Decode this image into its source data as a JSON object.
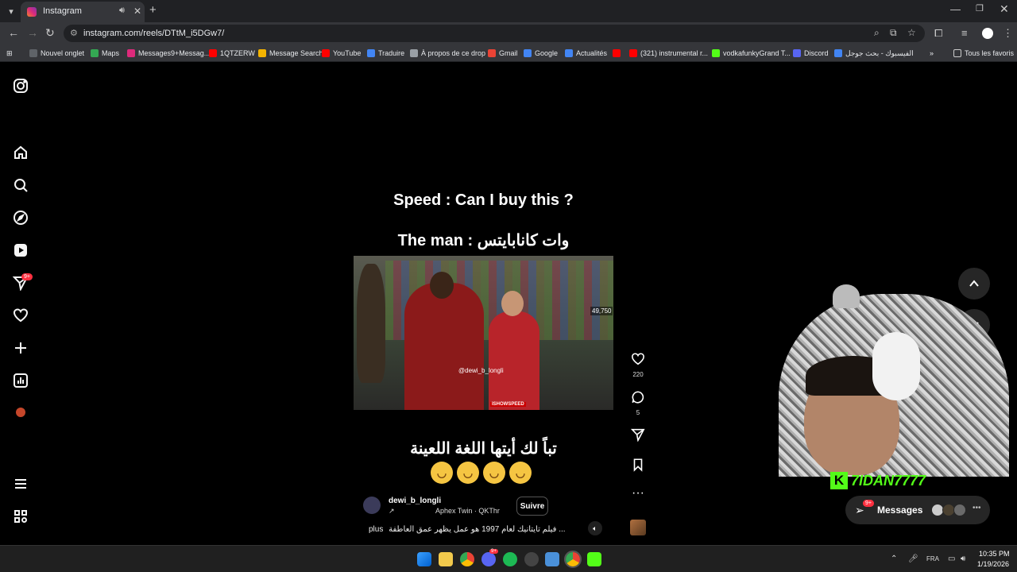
{
  "browser": {
    "tab_title": "Instagram",
    "url": "instagram.com/reels/DTtM_i5DGw7/",
    "bookmarks": [
      {
        "label": "Nouvel onglet",
        "color": "#5f6368"
      },
      {
        "label": "Maps",
        "color": "#34a853"
      },
      {
        "label": "Messages9+Messag...",
        "color": "#dd2a7b"
      },
      {
        "label": "1QTZERW",
        "color": "#ff0000"
      },
      {
        "label": "Message Search",
        "color": "#f4b400"
      },
      {
        "label": "YouTube",
        "color": "#ff0000"
      },
      {
        "label": "Traduire",
        "color": "#4285f4"
      },
      {
        "label": "À propos de ce drop",
        "color": "#9aa0a6"
      },
      {
        "label": "Gmail",
        "color": "#ea4335"
      },
      {
        "label": "Google",
        "color": "#4285f4"
      },
      {
        "label": "Actualités",
        "color": "#4285f4"
      },
      {
        "label": "",
        "color": "#ff0000"
      },
      {
        "label": "(321) instrumental r...",
        "color": "#ff0000"
      },
      {
        "label": "vodkafunkyGrand T...",
        "color": "#53fc18"
      },
      {
        "label": "Discord",
        "color": "#5865f2"
      },
      {
        "label": "الفيسبوك - بحث جوجل",
        "color": "#4285f4"
      }
    ],
    "all_bookmarks": "Tous les favoris"
  },
  "reel": {
    "caption_line1": "Speed : Can I buy this ?",
    "caption_line2": "The man : وات كانابايتس",
    "view_count": "49,750",
    "watermark": "@dewi_b_longli",
    "channel_logo": "ISHOWSPEED",
    "arabic_caption": "تباً لك أيتها اللغة اللعينة",
    "emoji_count": 4,
    "author": "dewi_b_longli",
    "audio_arrow": "↗",
    "audio_track": "Aphex Twin · QKThr",
    "follow_label": "Suivre",
    "description": "فيلم تايتانيك لعام 1997 هو عمل يظهر عمق العاطفة ...",
    "more_label": "plus",
    "likes": "220",
    "comments": "5"
  },
  "overlay": {
    "streamer_name": "7IDAN7777",
    "k_logo": "K"
  },
  "messages": {
    "label": "Messages",
    "badge": "9+"
  },
  "sidebar": {
    "notification_badge": "9+"
  },
  "taskbar": {
    "language": "FRA",
    "time": "10:35 PM",
    "date": "1/19/2026",
    "discord_badge": "9+"
  },
  "colors": {
    "accent_red": "#ff3040",
    "kick_green": "#53fc18",
    "chrome_dark": "#202124",
    "chrome_toolbar": "#35363a"
  }
}
